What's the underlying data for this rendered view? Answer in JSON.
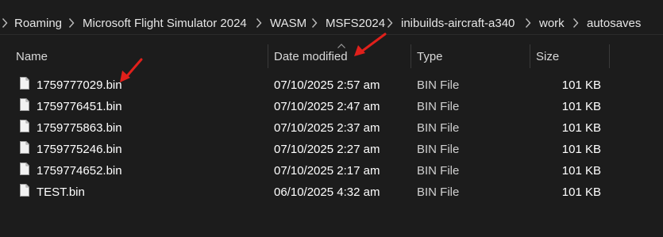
{
  "breadcrumb": {
    "items": [
      {
        "label": "Roaming"
      },
      {
        "label": "Microsoft Flight Simulator 2024"
      },
      {
        "label": "WASM"
      },
      {
        "label": "MSFS2024"
      },
      {
        "label": "inibuilds-aircraft-a340"
      },
      {
        "label": "work"
      },
      {
        "label": "autosaves"
      }
    ],
    "separator_icon": "chevron-right-icon"
  },
  "columns": {
    "name": "Name",
    "date_modified": "Date modified",
    "type": "Type",
    "size": "Size",
    "sort_icon": "chevron-up-icon"
  },
  "files": [
    {
      "name": "1759777029.bin",
      "date": "07/10/2025 2:57 am",
      "type": "BIN File",
      "size": "101 KB"
    },
    {
      "name": "1759776451.bin",
      "date": "07/10/2025 2:47 am",
      "type": "BIN File",
      "size": "101 KB"
    },
    {
      "name": "1759775863.bin",
      "date": "07/10/2025 2:37 am",
      "type": "BIN File",
      "size": "101 KB"
    },
    {
      "name": "1759775246.bin",
      "date": "07/10/2025 2:27 am",
      "type": "BIN File",
      "size": "101 KB"
    },
    {
      "name": "1759774652.bin",
      "date": "07/10/2025 2:17 am",
      "type": "BIN File",
      "size": "101 KB"
    },
    {
      "name": "TEST.bin",
      "date": "06/10/2025 4:32 am",
      "type": "BIN File",
      "size": "101 KB"
    }
  ],
  "file_icon": "file-icon",
  "annotation_icon": "red-arrow-icon",
  "colors": {
    "background": "#1c1c1c",
    "text": "#ffffff",
    "annotation": "#e0201b"
  }
}
